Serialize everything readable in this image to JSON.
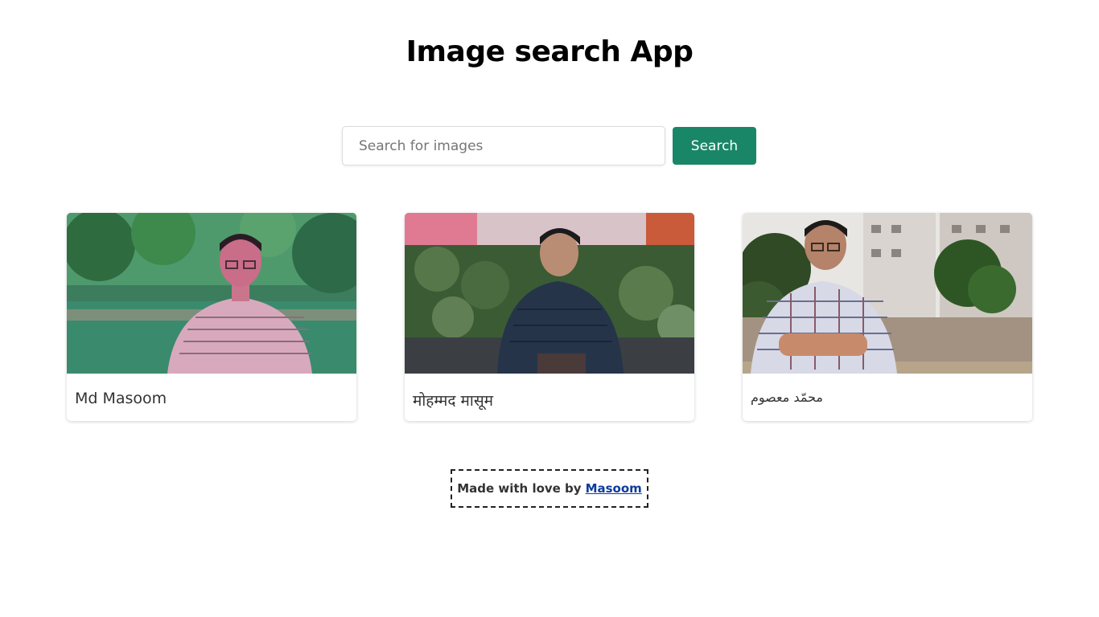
{
  "header": {
    "title": "Image search App"
  },
  "search": {
    "placeholder": "Search for images",
    "value": "",
    "button_label": "Search"
  },
  "results": [
    {
      "caption": "Md Masoom",
      "colors": {
        "sky": "#3e8a6a",
        "foliage": "#2f7a4f",
        "subject": "#d9a3b8"
      }
    },
    {
      "caption": "मोहम्मद मासूम",
      "colors": {
        "sky": "#c9606a",
        "foliage": "#3d5d34",
        "subject": "#2c3a4d"
      }
    },
    {
      "caption": "محمّد معصوم",
      "colors": {
        "sky": "#e8e4e0",
        "foliage": "#3a5d2e",
        "subject": "#8a8fa8"
      }
    }
  ],
  "footer": {
    "text": "Made with love by",
    "link_label": "Masoom"
  },
  "theme": {
    "accent": "#1a8668",
    "link": "#0b3c9e"
  }
}
